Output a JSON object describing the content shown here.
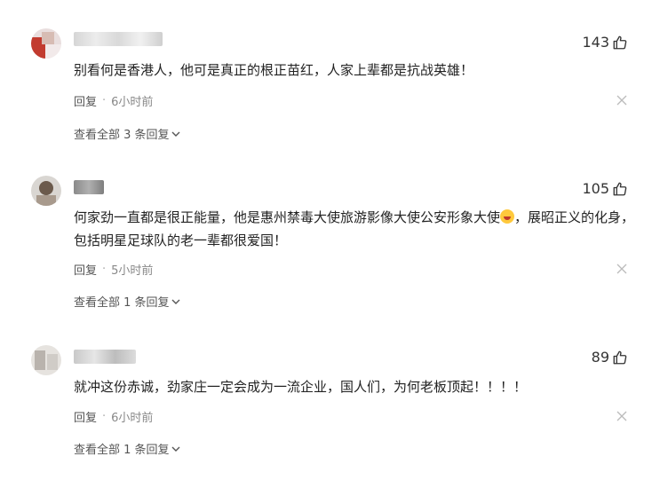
{
  "comments": [
    {
      "likes": "143",
      "text": "别看何是香港人，他可是真正的根正苗红，人家上辈都是抗战英雄！",
      "reply_label": "回复",
      "time": "6小时前",
      "view_replies": "查看全部 3 条回复"
    },
    {
      "likes": "105",
      "text_before_emoji": "何家劲一直都是很正能量，他是惠州禁毒大使旅游影像大使公安形象大使",
      "text_after_emoji": "，展昭正义的化身，包括明星足球队的老一辈都很爱国！",
      "reply_label": "回复",
      "time": "5小时前",
      "view_replies": "查看全部 1 条回复"
    },
    {
      "likes": "89",
      "text": "就冲这份赤诚，劲家庄一定会成为一流企业，国人们，为何老板顶起！！！！",
      "reply_label": "回复",
      "time": "6小时前",
      "view_replies": "查看全部 1 条回复"
    }
  ],
  "icons": {
    "like": "thumbs-up-icon",
    "close": "close-icon",
    "expand": "chevron-down-icon",
    "emoji": "grin-emoji-icon"
  },
  "colors": {
    "text": "#222222",
    "meta": "#888888",
    "link": "#555555"
  }
}
